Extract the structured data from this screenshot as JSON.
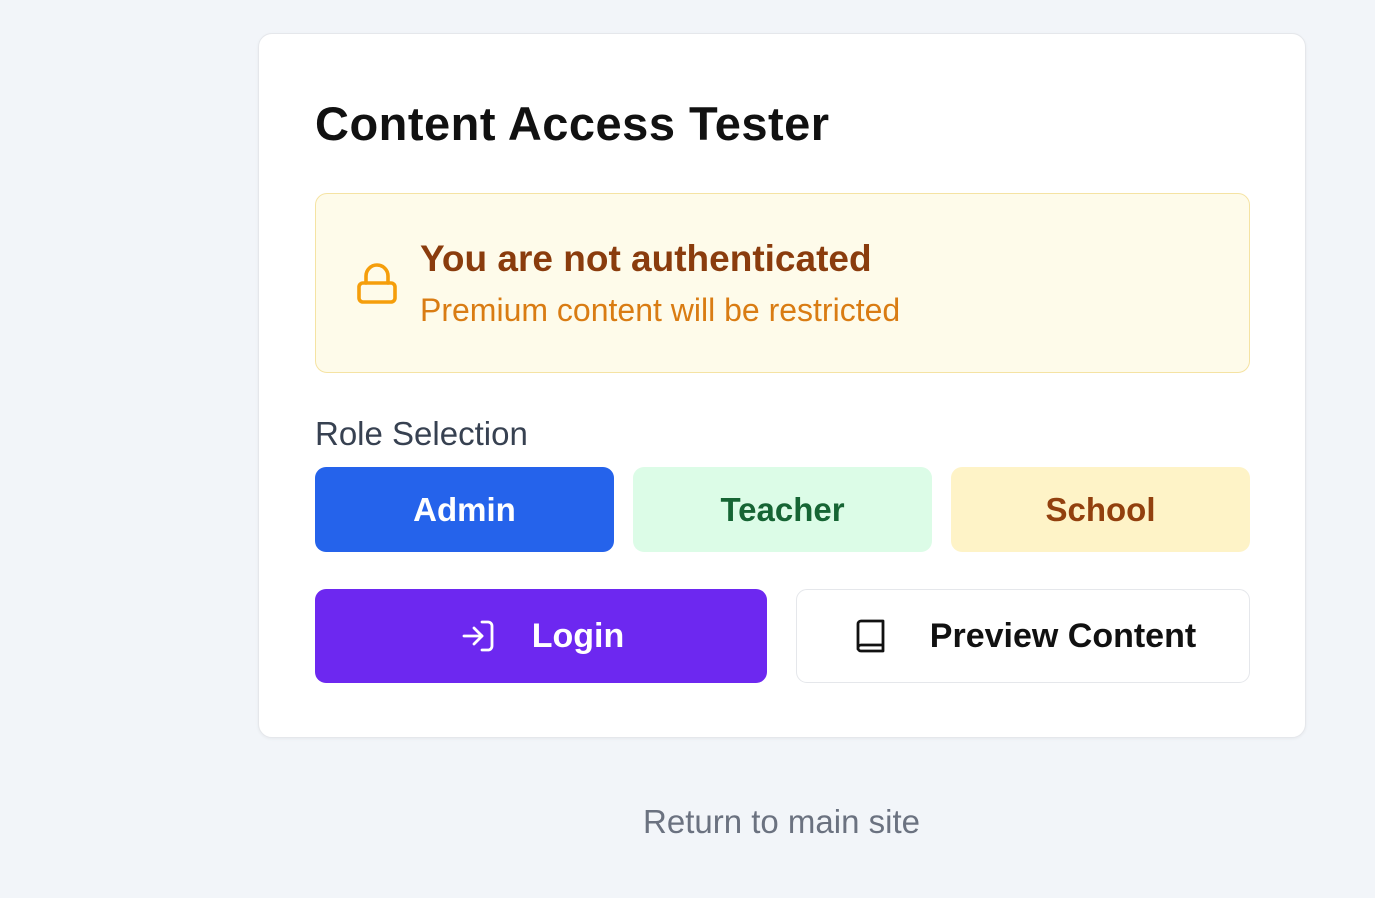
{
  "card": {
    "title": "Content Access Tester"
  },
  "auth_alert": {
    "title": "You are not authenticated",
    "subtitle": "Premium content will be restricted",
    "icon": "lock-icon"
  },
  "role_selection": {
    "label": "Role Selection",
    "roles": [
      {
        "label": "Admin",
        "color": "#2563eb",
        "selected": true
      },
      {
        "label": "Teacher",
        "color": "#dcfce7"
      },
      {
        "label": "School",
        "color": "#fef3c7"
      }
    ]
  },
  "actions": {
    "login_label": "Login",
    "login_icon": "login-icon",
    "preview_label": "Preview Content",
    "preview_icon": "book-icon"
  },
  "footer": {
    "return_link": "Return to main site"
  },
  "colors": {
    "primary": "#2563eb",
    "login": "#6d28f0",
    "warning_bg": "#fefbea",
    "warning_text": "#8a3c0d",
    "warning_accent": "#d97c13"
  }
}
